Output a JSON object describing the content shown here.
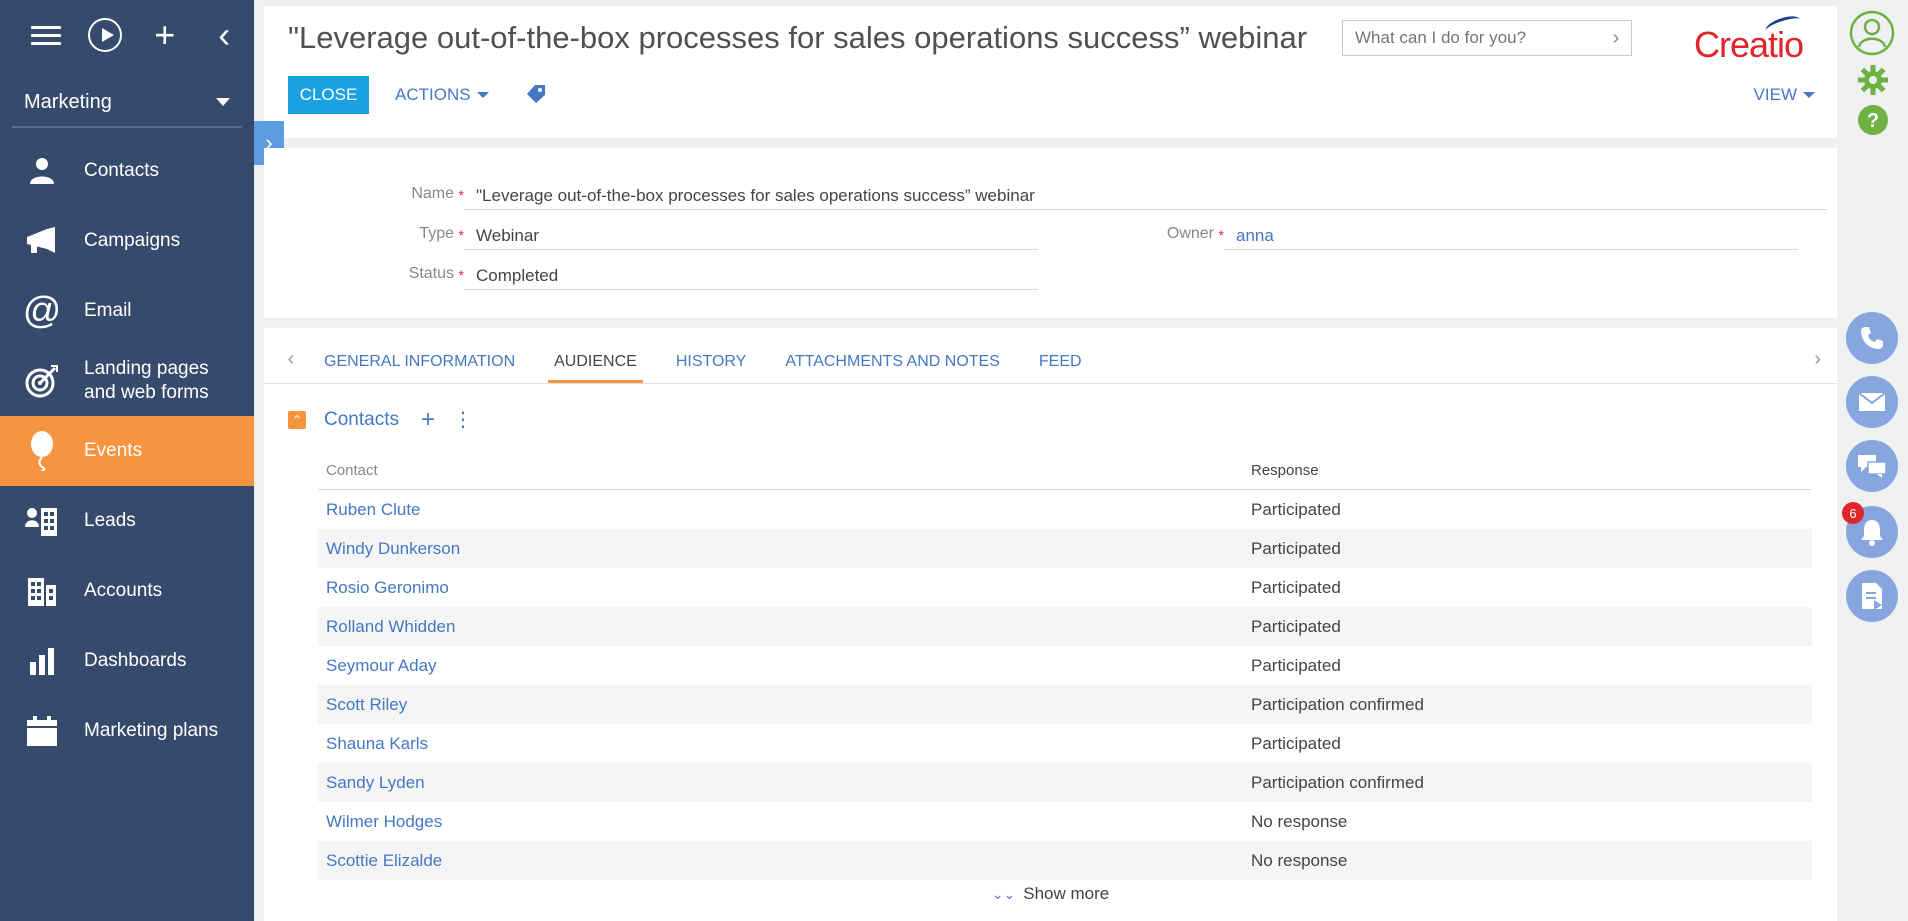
{
  "sidebar": {
    "workplace": "Marketing",
    "items": [
      {
        "label": "Contacts",
        "icon": "person-icon"
      },
      {
        "label": "Campaigns",
        "icon": "megaphone-icon"
      },
      {
        "label": "Email",
        "icon": "at-sign-icon"
      },
      {
        "label": "Landing pages and web forms",
        "icon": "target-icon"
      },
      {
        "label": "Events",
        "icon": "balloon-icon",
        "active": true
      },
      {
        "label": "Leads",
        "icon": "leads-icon"
      },
      {
        "label": "Accounts",
        "icon": "building-icon"
      },
      {
        "label": "Dashboards",
        "icon": "bar-chart-icon"
      },
      {
        "label": "Marketing plans",
        "icon": "calendar-icon"
      }
    ]
  },
  "header": {
    "title": "\"Leverage out-of-the-box processes for sales operations success” webinar",
    "search_placeholder": "What can I do for you?",
    "logo": "Creatio",
    "close_label": "CLOSE",
    "actions_label": "ACTIONS",
    "view_label": "VIEW"
  },
  "fields": {
    "name_label": "Name",
    "name_value": "\"Leverage out-of-the-box processes for sales operations success” webinar",
    "type_label": "Type",
    "type_value": "Webinar",
    "status_label": "Status",
    "status_value": "Completed",
    "owner_label": "Owner",
    "owner_value": "anna",
    "required_mark": "*"
  },
  "tabs": [
    {
      "label": "GENERAL INFORMATION"
    },
    {
      "label": "AUDIENCE",
      "active": true
    },
    {
      "label": "HISTORY"
    },
    {
      "label": "ATTACHMENTS AND NOTES"
    },
    {
      "label": "FEED"
    }
  ],
  "audience": {
    "group_title": "Contacts",
    "columns": {
      "contact": "Contact",
      "response": "Response"
    },
    "rows": [
      {
        "contact": "Ruben Clute",
        "response": "Participated"
      },
      {
        "contact": "Windy Dunkerson",
        "response": "Participated"
      },
      {
        "contact": "Rosio Geronimo",
        "response": "Participated"
      },
      {
        "contact": "Rolland Whidden",
        "response": "Participated"
      },
      {
        "contact": "Seymour Aday",
        "response": "Participated"
      },
      {
        "contact": "Scott Riley",
        "response": "Participation confirmed"
      },
      {
        "contact": "Shauna Karls",
        "response": "Participated"
      },
      {
        "contact": "Sandy Lyden",
        "response": "Participation confirmed"
      },
      {
        "contact": "Wilmer Hodges",
        "response": "No response"
      },
      {
        "contact": "Scottie Elizalde",
        "response": "No response"
      }
    ],
    "show_more": "Show more"
  },
  "rail": {
    "notification_count": "6"
  },
  "colors": {
    "sidebar_bg": "#364a6c",
    "accent_orange": "#f7943f",
    "link_blue": "#4478c5",
    "close_button": "#1aa1e2",
    "brand_red": "#e1252a"
  }
}
